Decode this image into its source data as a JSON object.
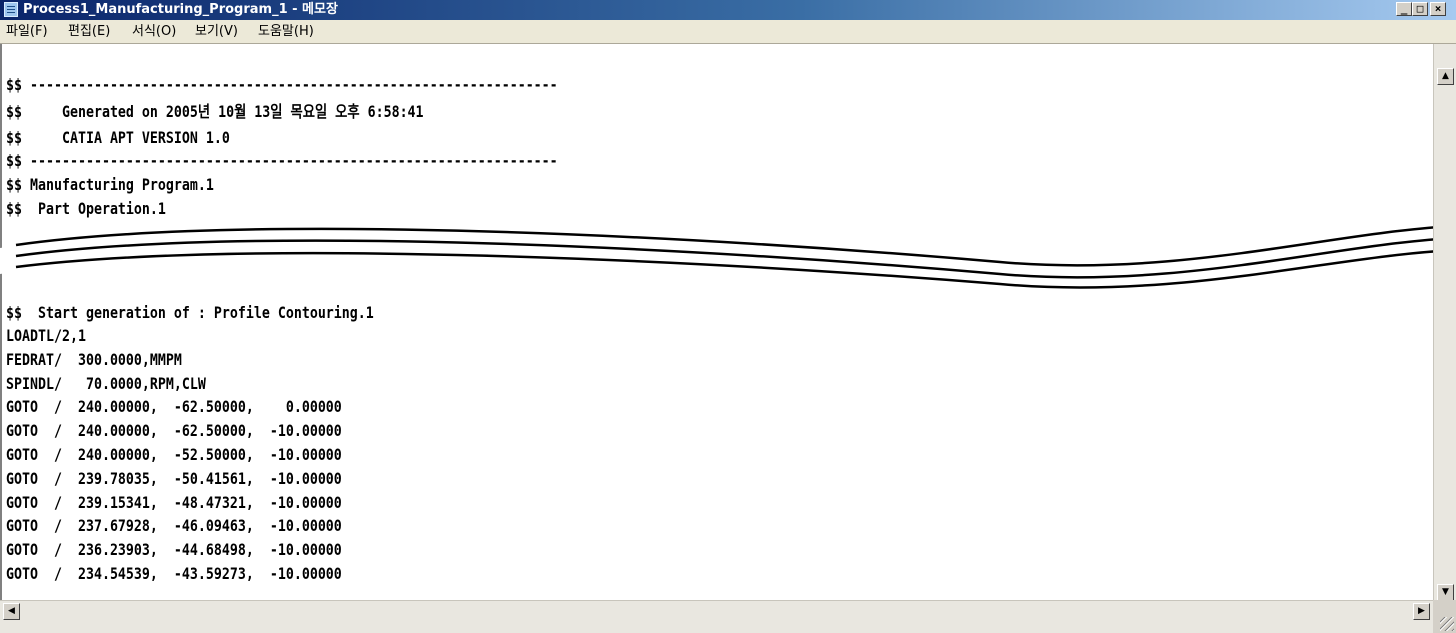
{
  "window": {
    "title": "Process1_Manufacturing_Program_1 - 메모장",
    "min_glyph": "_",
    "max_glyph": "□",
    "close_glyph": "×"
  },
  "menu": {
    "items": [
      {
        "label": "파일(F)"
      },
      {
        "label": "편집(E)"
      },
      {
        "label": "서식(O)"
      },
      {
        "label": "보기(V)"
      },
      {
        "label": "도움말(H)"
      }
    ]
  },
  "document": {
    "top_lines": [
      "$$ ------------------------------------------------------------------",
      "$$     Generated on 2005년 10월 13일 목요일 오후 6:58:41",
      "$$     CATIA APT VERSION 1.0",
      "$$ ------------------------------------------------------------------",
      "$$ Manufacturing Program.1",
      "$$  Part Operation.1"
    ],
    "bottom_lines": [
      "$$  Start generation of : Profile Contouring.1",
      "LOADTL/2,1",
      "FEDRAT/  300.0000,MMPM",
      "SPINDL/   70.0000,RPM,CLW",
      "GOTO  /  240.00000,  -62.50000,    0.00000",
      "GOTO  /  240.00000,  -62.50000,  -10.00000",
      "GOTO  /  240.00000,  -52.50000,  -10.00000",
      "GOTO  /  239.78035,  -50.41561,  -10.00000",
      "GOTO  /  239.15341,  -48.47321,  -10.00000",
      "GOTO  /  237.67928,  -46.09463,  -10.00000",
      "GOTO  /  236.23903,  -44.68498,  -10.00000",
      "GOTO  /  234.54539,  -43.59273,  -10.00000"
    ]
  },
  "scrollbar": {
    "up_glyph": "▲",
    "down_glyph": "▼",
    "left_glyph": "◀",
    "right_glyph": "▶"
  },
  "colors": {
    "titlebar_start": "#0a246a",
    "titlebar_end": "#a6caf0",
    "chrome": "#ece9d8"
  }
}
